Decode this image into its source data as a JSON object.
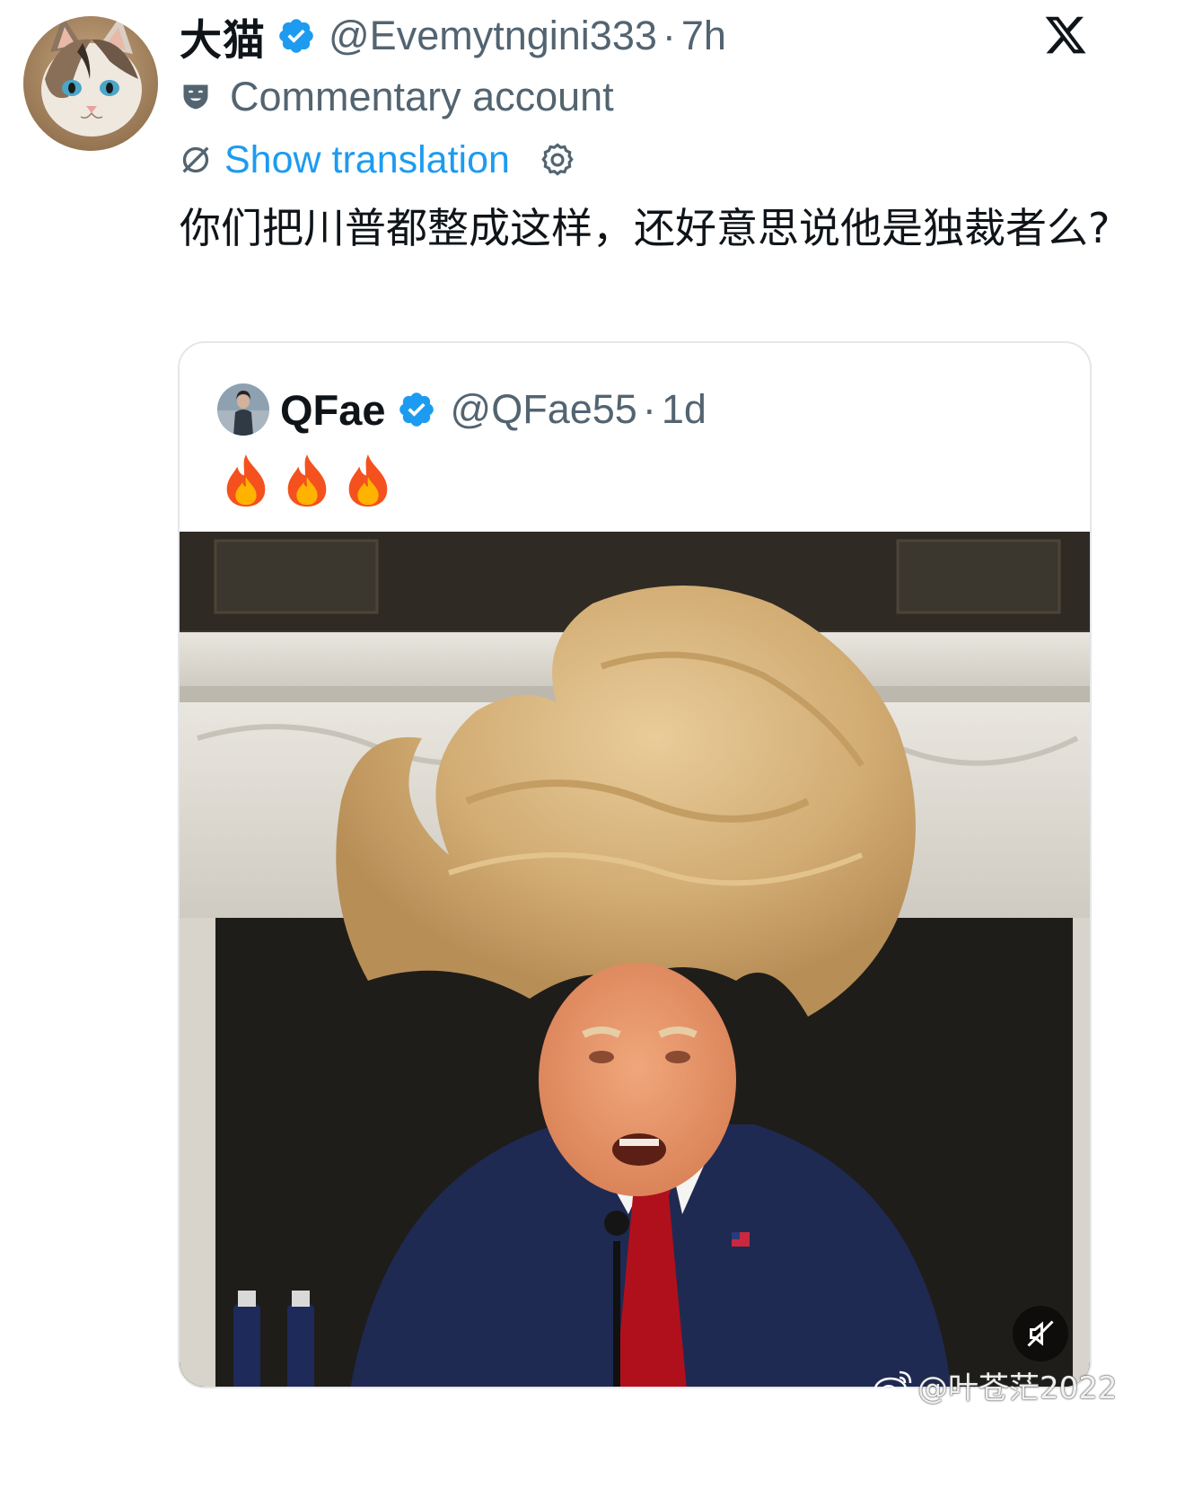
{
  "tweet": {
    "author": {
      "display_name": "大猫",
      "handle": "@Evemytngini333",
      "separator": "·",
      "time": "7h",
      "verified": true,
      "avatar": "cat-avatar"
    },
    "account_label": {
      "icon": "theater-mask-icon",
      "text": "Commentary account"
    },
    "translation": {
      "icon": "translate-icon",
      "link_text": "Show translation",
      "settings_icon": "gear-icon"
    },
    "text": "你们把川普都整成这样，还好意思说他是独裁者么?",
    "close_icon": "x-logo-icon"
  },
  "quoted_tweet": {
    "author": {
      "display_name": "QFae",
      "handle": "@QFae55",
      "separator": "·",
      "time": "1d",
      "verified": true,
      "avatar": "woman-avatar"
    },
    "text_emojis": [
      "fire-emoji",
      "fire-emoji",
      "fire-emoji"
    ],
    "media": {
      "type": "photo",
      "description_icon": "photo-man-with-windblown-blonde-hair",
      "mute_icon": "muted-speaker-icon"
    }
  },
  "watermark": {
    "icon": "weibo-icon",
    "text": "@叶苍茫2022"
  },
  "colors": {
    "text_primary": "#0f1419",
    "text_secondary": "#536471",
    "link_blue": "#1d9bf0",
    "border": "#e3e7ea"
  }
}
